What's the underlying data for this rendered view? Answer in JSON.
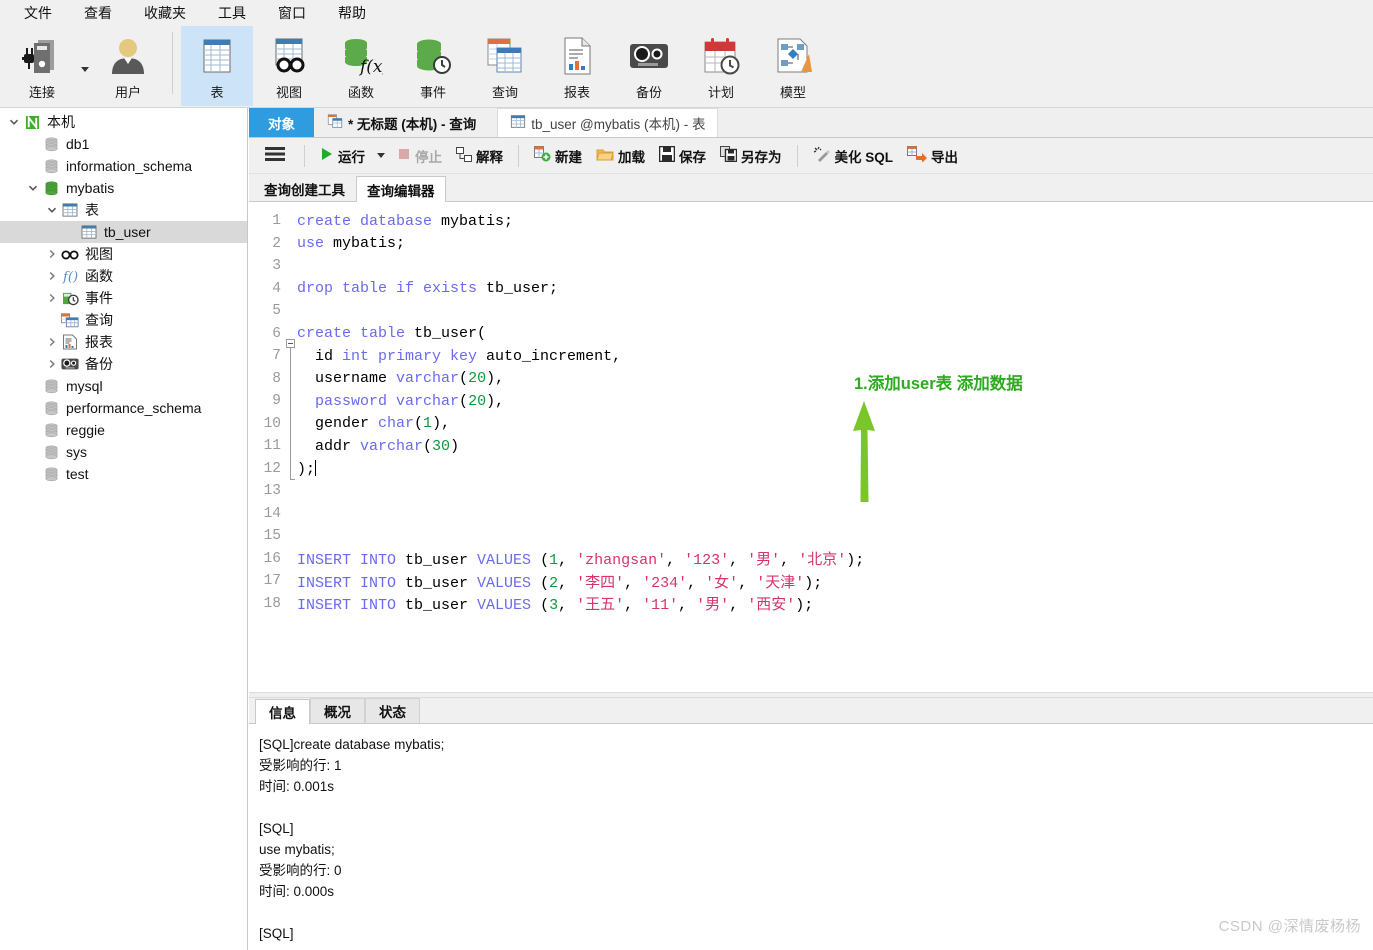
{
  "menu": {
    "items": [
      {
        "label": "文件",
        "name": "menu-file"
      },
      {
        "label": "查看",
        "name": "menu-view"
      },
      {
        "label": "收藏夹",
        "name": "menu-favorites"
      },
      {
        "label": "工具",
        "name": "menu-tools"
      },
      {
        "label": "窗口",
        "name": "menu-window"
      },
      {
        "label": "帮助",
        "name": "menu-help"
      }
    ]
  },
  "toolbar": {
    "items": [
      {
        "label": "连接",
        "icon": "connection-icon",
        "selected": false
      },
      {
        "label": "用户",
        "icon": "user-icon",
        "selected": false
      },
      {
        "label": "表",
        "icon": "table-icon",
        "selected": true
      },
      {
        "label": "视图",
        "icon": "view-icon",
        "selected": false
      },
      {
        "label": "函数",
        "icon": "function-icon",
        "selected": false
      },
      {
        "label": "事件",
        "icon": "event-icon",
        "selected": false
      },
      {
        "label": "查询",
        "icon": "query-icon",
        "selected": false
      },
      {
        "label": "报表",
        "icon": "report-icon",
        "selected": false
      },
      {
        "label": "备份",
        "icon": "backup-icon",
        "selected": false
      },
      {
        "label": "计划",
        "icon": "schedule-icon",
        "selected": false
      },
      {
        "label": "模型",
        "icon": "model-icon",
        "selected": false
      }
    ]
  },
  "sidebar": {
    "nodes": [
      {
        "label": "本机",
        "indent": 0,
        "twisty": "down",
        "icon": "navicat-conn-icon",
        "selected": false
      },
      {
        "label": "db1",
        "indent": 1,
        "twisty": "",
        "icon": "database-icon",
        "selected": false
      },
      {
        "label": "information_schema",
        "indent": 1,
        "twisty": "",
        "icon": "database-icon",
        "selected": false
      },
      {
        "label": "mybatis",
        "indent": 1,
        "twisty": "down",
        "icon": "database-open-icon",
        "selected": false
      },
      {
        "label": "表",
        "indent": 2,
        "twisty": "down",
        "icon": "table-icon",
        "selected": false
      },
      {
        "label": "tb_user",
        "indent": 3,
        "twisty": "",
        "icon": "table-icon",
        "selected": true
      },
      {
        "label": "视图",
        "indent": 2,
        "twisty": "right",
        "icon": "view-icon",
        "selected": false
      },
      {
        "label": "函数",
        "indent": 2,
        "twisty": "right",
        "icon": "function-icon",
        "selected": false
      },
      {
        "label": "事件",
        "indent": 2,
        "twisty": "right",
        "icon": "event-icon",
        "selected": false
      },
      {
        "label": "查询",
        "indent": 2,
        "twisty": "",
        "icon": "query-icon",
        "selected": false
      },
      {
        "label": "报表",
        "indent": 2,
        "twisty": "right",
        "icon": "report-icon",
        "selected": false
      },
      {
        "label": "备份",
        "indent": 2,
        "twisty": "right",
        "icon": "backup-icon",
        "selected": false
      },
      {
        "label": "mysql",
        "indent": 1,
        "twisty": "",
        "icon": "database-icon",
        "selected": false
      },
      {
        "label": "performance_schema",
        "indent": 1,
        "twisty": "",
        "icon": "database-icon",
        "selected": false
      },
      {
        "label": "reggie",
        "indent": 1,
        "twisty": "",
        "icon": "database-icon",
        "selected": false
      },
      {
        "label": "sys",
        "indent": 1,
        "twisty": "",
        "icon": "database-icon",
        "selected": false
      },
      {
        "label": "test",
        "indent": 1,
        "twisty": "",
        "icon": "database-icon",
        "selected": false
      }
    ]
  },
  "tabs": {
    "objects_label": "对象",
    "query_tab_label": "* 无标题 (本机) - 查询",
    "table_tab_label": "tb_user @mybatis (本机) - 表"
  },
  "editor_toolbar": {
    "menu_icon": "hamburger-icon",
    "buttons": [
      {
        "label": "运行",
        "icon": "run-icon",
        "disabled": false
      },
      {
        "label": "停止",
        "icon": "stop-icon",
        "disabled": true
      },
      {
        "label": "解释",
        "icon": "explain-icon",
        "disabled": false
      },
      {
        "label": "新建",
        "icon": "new-icon",
        "disabled": false
      },
      {
        "label": "加载",
        "icon": "load-icon",
        "disabled": false
      },
      {
        "label": "保存",
        "icon": "save-icon",
        "disabled": false
      },
      {
        "label": "另存为",
        "icon": "save-as-icon",
        "disabled": false
      },
      {
        "label": "美化 SQL",
        "icon": "beautify-icon",
        "disabled": false
      },
      {
        "label": "导出",
        "icon": "export-icon",
        "disabled": false
      }
    ]
  },
  "subtabs": [
    {
      "label": "查询创建工具",
      "active": false
    },
    {
      "label": "查询编辑器",
      "active": true
    }
  ],
  "editor": {
    "lines": [
      {
        "num": 1,
        "tokens": [
          {
            "t": "create ",
            "c": "k"
          },
          {
            "t": "database ",
            "c": "k"
          },
          {
            "t": "mybatis;",
            "c": "idn"
          }
        ]
      },
      {
        "num": 2,
        "tokens": [
          {
            "t": "use ",
            "c": "k"
          },
          {
            "t": "mybatis;",
            "c": "idn"
          }
        ]
      },
      {
        "num": 3,
        "tokens": []
      },
      {
        "num": 4,
        "tokens": [
          {
            "t": "drop table if exists ",
            "c": "k"
          },
          {
            "t": "tb_user;",
            "c": "idn"
          }
        ]
      },
      {
        "num": 5,
        "tokens": []
      },
      {
        "num": 6,
        "fold": "start",
        "tokens": [
          {
            "t": "create table ",
            "c": "k"
          },
          {
            "t": "tb_user(",
            "c": "idn"
          }
        ]
      },
      {
        "num": 7,
        "fold": "mid",
        "tokens": [
          {
            "t": "  id ",
            "c": "idn"
          },
          {
            "t": "int primary key ",
            "c": "k"
          },
          {
            "t": "auto_increment,",
            "c": "idn"
          }
        ]
      },
      {
        "num": 8,
        "fold": "mid",
        "tokens": [
          {
            "t": "  username ",
            "c": "idn"
          },
          {
            "t": "varchar",
            "c": "k"
          },
          {
            "t": "(",
            "c": "idn"
          },
          {
            "t": "20",
            "c": "n"
          },
          {
            "t": "),",
            "c": "idn"
          }
        ]
      },
      {
        "num": 9,
        "fold": "mid",
        "tokens": [
          {
            "t": "  ",
            "c": "idn"
          },
          {
            "t": "password ",
            "c": "k"
          },
          {
            "t": "varchar",
            "c": "k"
          },
          {
            "t": "(",
            "c": "idn"
          },
          {
            "t": "20",
            "c": "n"
          },
          {
            "t": "),",
            "c": "idn"
          }
        ]
      },
      {
        "num": 10,
        "fold": "mid",
        "tokens": [
          {
            "t": "  gender ",
            "c": "idn"
          },
          {
            "t": "char",
            "c": "k"
          },
          {
            "t": "(",
            "c": "idn"
          },
          {
            "t": "1",
            "c": "n"
          },
          {
            "t": "),",
            "c": "idn"
          }
        ]
      },
      {
        "num": 11,
        "fold": "mid",
        "tokens": [
          {
            "t": "  addr ",
            "c": "idn"
          },
          {
            "t": "varchar",
            "c": "k"
          },
          {
            "t": "(",
            "c": "idn"
          },
          {
            "t": "30",
            "c": "n"
          },
          {
            "t": ")",
            "c": "idn"
          }
        ]
      },
      {
        "num": 12,
        "fold": "end",
        "tokens": [
          {
            "t": ");",
            "c": "idn"
          }
        ],
        "caret": true
      },
      {
        "num": 13,
        "tokens": []
      },
      {
        "num": 14,
        "tokens": []
      },
      {
        "num": 15,
        "tokens": []
      },
      {
        "num": 16,
        "tokens": [
          {
            "t": "INSERT INTO ",
            "c": "k"
          },
          {
            "t": "tb_user ",
            "c": "idn"
          },
          {
            "t": "VALUES ",
            "c": "k"
          },
          {
            "t": "(",
            "c": "idn"
          },
          {
            "t": "1",
            "c": "n"
          },
          {
            "t": ", ",
            "c": "idn"
          },
          {
            "t": "'zhangsan'",
            "c": "s"
          },
          {
            "t": ", ",
            "c": "idn"
          },
          {
            "t": "'123'",
            "c": "s"
          },
          {
            "t": ", ",
            "c": "idn"
          },
          {
            "t": "'男'",
            "c": "s"
          },
          {
            "t": ", ",
            "c": "idn"
          },
          {
            "t": "'北京'",
            "c": "s"
          },
          {
            "t": ");",
            "c": "idn"
          }
        ]
      },
      {
        "num": 17,
        "tokens": [
          {
            "t": "INSERT INTO ",
            "c": "k"
          },
          {
            "t": "tb_user ",
            "c": "idn"
          },
          {
            "t": "VALUES ",
            "c": "k"
          },
          {
            "t": "(",
            "c": "idn"
          },
          {
            "t": "2",
            "c": "n"
          },
          {
            "t": ", ",
            "c": "idn"
          },
          {
            "t": "'李四'",
            "c": "s"
          },
          {
            "t": ", ",
            "c": "idn"
          },
          {
            "t": "'234'",
            "c": "s"
          },
          {
            "t": ", ",
            "c": "idn"
          },
          {
            "t": "'女'",
            "c": "s"
          },
          {
            "t": ", ",
            "c": "idn"
          },
          {
            "t": "'天津'",
            "c": "s"
          },
          {
            "t": ");",
            "c": "idn"
          }
        ]
      },
      {
        "num": 18,
        "tokens": [
          {
            "t": "INSERT INTO ",
            "c": "k"
          },
          {
            "t": "tb_user ",
            "c": "idn"
          },
          {
            "t": "VALUES ",
            "c": "k"
          },
          {
            "t": "(",
            "c": "idn"
          },
          {
            "t": "3",
            "c": "n"
          },
          {
            "t": ", ",
            "c": "idn"
          },
          {
            "t": "'王五'",
            "c": "s"
          },
          {
            "t": ", ",
            "c": "idn"
          },
          {
            "t": "'11'",
            "c": "s"
          },
          {
            "t": ", ",
            "c": "idn"
          },
          {
            "t": "'男'",
            "c": "s"
          },
          {
            "t": ", ",
            "c": "idn"
          },
          {
            "t": "'西安'",
            "c": "s"
          },
          {
            "t": ");",
            "c": "idn"
          }
        ]
      }
    ]
  },
  "annotation": {
    "text": "1.添加user表 添加数据",
    "color": "#2eaa20",
    "arrow": "up-arrow-annotation"
  },
  "results": {
    "tabs": [
      {
        "label": "信息",
        "active": true
      },
      {
        "label": "概况",
        "active": false
      },
      {
        "label": "状态",
        "active": false
      }
    ],
    "log": "[SQL]create database mybatis;\n受影响的行: 1\n时间: 0.001s\n\n[SQL]\nuse mybatis;\n受影响的行: 0\n时间: 0.000s\n\n[SQL]"
  },
  "watermark": "CSDN @深情废杨杨"
}
